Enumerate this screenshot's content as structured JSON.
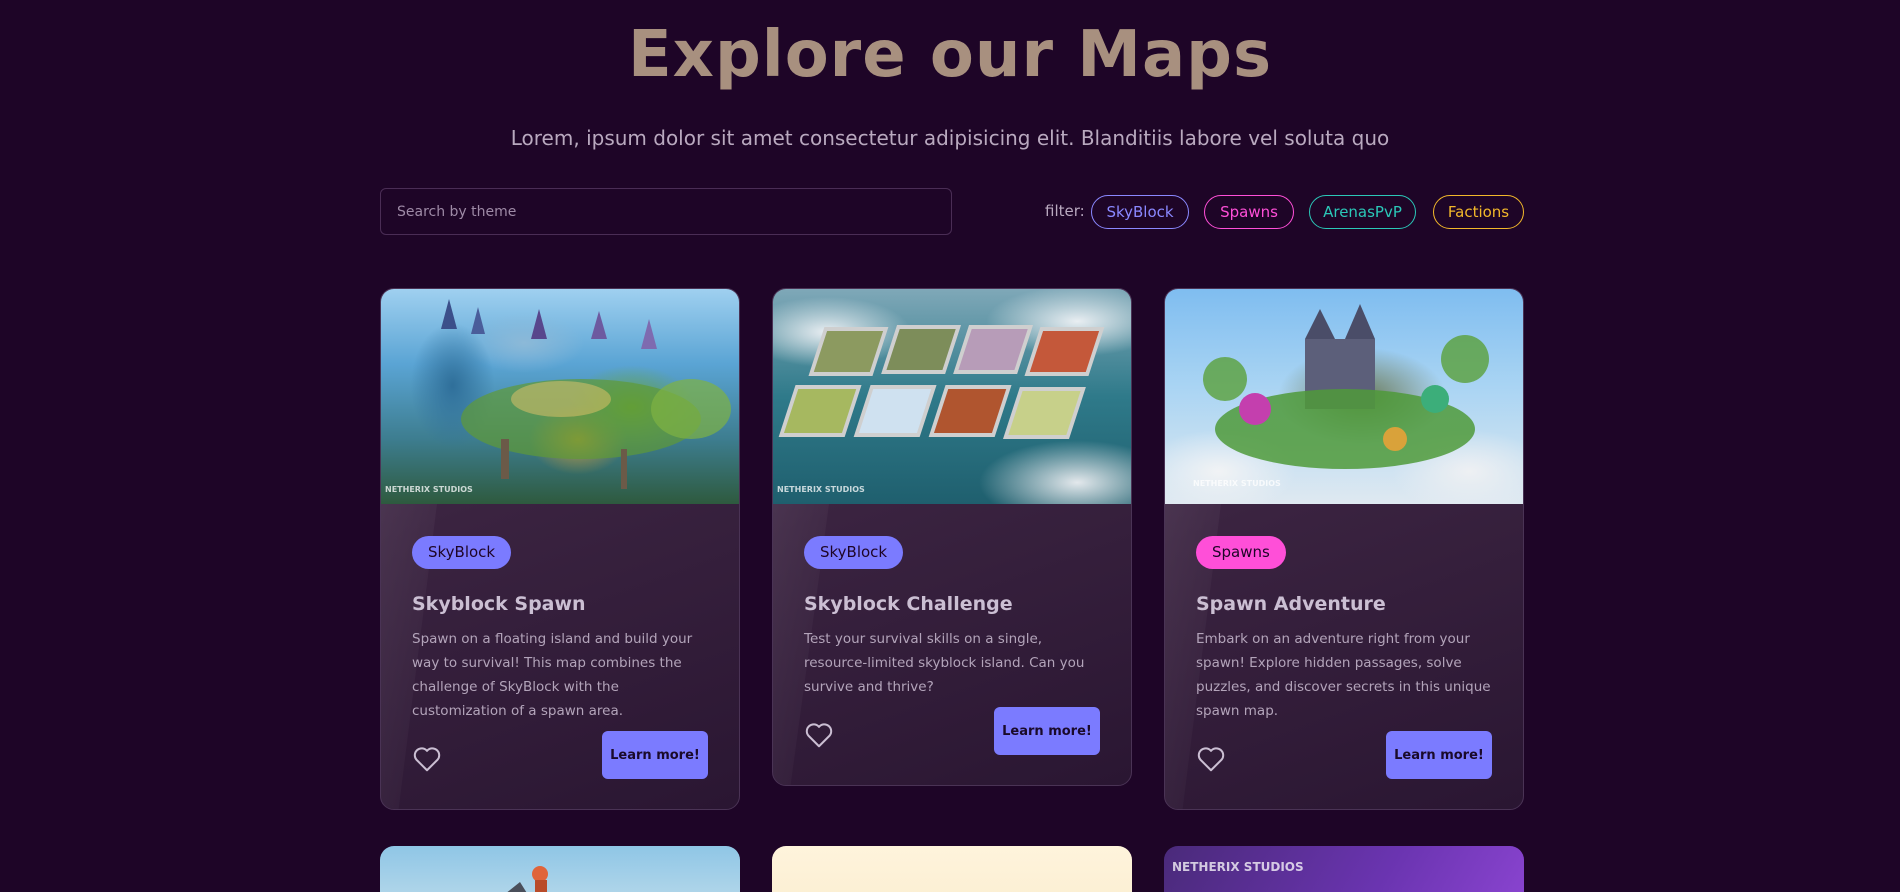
{
  "header": {
    "title": "Explore our Maps",
    "subtitle": "Lorem, ipsum dolor sit amet consectetur adipisicing elit. Blanditiis labore vel soluta quo"
  },
  "search": {
    "placeholder": "Search by theme",
    "value": ""
  },
  "filter": {
    "label": "filter:",
    "options": [
      {
        "label": "SkyBlock",
        "color": "#8a88ff"
      },
      {
        "label": "Spawns",
        "color": "#ff4fd8"
      },
      {
        "label": "ArenasPvP",
        "color": "#2bc8b8"
      },
      {
        "label": "Factions",
        "color": "#f2b82a"
      }
    ]
  },
  "cards": [
    {
      "tag": "SkyBlock",
      "tag_color": "#7b7bff",
      "title": "Skyblock Spawn",
      "description": "Spawn on a floating island and build your way to survival! This map combines the challenge of SkyBlock with the customization of a spawn area.",
      "button": "Learn more!",
      "watermark": "NETHERIX STUDIOS"
    },
    {
      "tag": "SkyBlock",
      "tag_color": "#7b7bff",
      "title": "Skyblock Challenge",
      "description": "Test your survival skills on a single, resource-limited skyblock island. Can you survive and thrive?",
      "button": "Learn more!",
      "watermark": "NETHERIX STUDIOS"
    },
    {
      "tag": "Spawns",
      "tag_color": "#ff4fd8",
      "title": "Spawn Adventure",
      "description": "Embark on an adventure right from your spawn! Explore hidden passages, solve puzzles, and discover secrets in this unique spawn map.",
      "button": "Learn more!",
      "watermark": "NETHERIX STUDIOS"
    }
  ],
  "second_row": {
    "watermark": "NETHERIX STUDIOS"
  }
}
